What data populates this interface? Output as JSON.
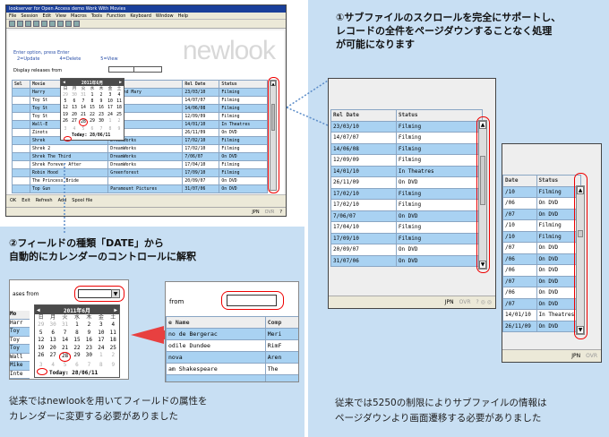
{
  "main_window": {
    "title": "lookserver for Open Access demo Work With Movies",
    "menu": [
      "File",
      "Session",
      "Edit",
      "View",
      "Macros",
      "Tools",
      "Function",
      "Keyboard",
      "Window",
      "Help"
    ],
    "brand": "newlook",
    "options_label": "Enter option, press Enter",
    "options": [
      "2=Update",
      "4=Delete",
      "5=View"
    ],
    "display_label": "Display releases from",
    "columns": [
      "Sel",
      "Movie",
      "",
      "Rel Date",
      "Status"
    ],
    "rows": [
      [
        "",
        "Harry",
        "ng, and Mary",
        "23/03/10",
        "Filming"
      ],
      [
        "",
        "Toy St",
        "Pixar",
        "14/07/07",
        "Filming"
      ],
      [
        "",
        "Toy St",
        "Pixar",
        "14/06/08",
        "Filming"
      ],
      [
        "",
        "Toy St",
        "Pixar",
        "12/09/09",
        "Filming"
      ],
      [
        "",
        "Wall-E",
        "Pixar",
        "14/01/10",
        "In Theatres"
      ],
      [
        "",
        "Zinots",
        "Pixar",
        "26/11/09",
        "On DVD"
      ],
      [
        "",
        "Shrek",
        "DreamWorks",
        "17/02/10",
        "Filming"
      ],
      [
        "",
        "Shrek 2",
        "DreamWorks",
        "17/02/10",
        "Filming"
      ],
      [
        "",
        "Shrek The Third",
        "DreamWorks",
        "7/06/07",
        "On DVD"
      ],
      [
        "",
        "Shrek Forever After",
        "DreamWorks",
        "17/04/10",
        "Filming"
      ],
      [
        "",
        "Robin Hood",
        "Greenforest",
        "17/09/10",
        "Filming"
      ],
      [
        "",
        "The Princess Bride",
        "",
        "20/09/07",
        "On DVD"
      ],
      [
        "",
        "Top Gun",
        "Paramount Pictures",
        "31/07/06",
        "On DVD"
      ]
    ],
    "bottom_buttons": [
      "OK",
      "Exit",
      "Refresh",
      "Add",
      "Spool file"
    ],
    "status": [
      "JPN",
      "OVR",
      "?"
    ]
  },
  "calendar": {
    "month": "2011年6月",
    "weekdays": [
      "日",
      "月",
      "火",
      "水",
      "木",
      "金",
      "土"
    ],
    "days": [
      "29",
      "30",
      "31",
      "1",
      "2",
      "3",
      "4",
      "5",
      "6",
      "7",
      "8",
      "9",
      "10",
      "11",
      "12",
      "13",
      "14",
      "15",
      "16",
      "17",
      "18",
      "19",
      "20",
      "21",
      "22",
      "23",
      "24",
      "25",
      "26",
      "27",
      "28",
      "29",
      "30",
      "1",
      "2",
      "3",
      "4",
      "5",
      "6",
      "7",
      "8",
      "9"
    ],
    "today_label": "Today: 28/06/11",
    "selected": "28"
  },
  "annotation1": {
    "title": "①サブファイルのスクロールを完全にサポートし、\nレコードの全件をページダウンすることなく処理\nが可能になります",
    "note": "従来では5250の制限によりサブファイルの情報は\nページダウンより画面遷移する必要がありました"
  },
  "annotation2": {
    "title": "②フィールドの種類「DATE」から\n自動的にカレンダーのコントロールに解釈",
    "note": "従来ではnewlookを用いてフィールドの属性を\nカレンダーに変更する必要がありました"
  },
  "zoom_subfile": {
    "columns": [
      "Rel Date",
      "Status"
    ],
    "rows": [
      [
        "23/03/10",
        "Filming"
      ],
      [
        "14/07/07",
        "Filming"
      ],
      [
        "14/06/08",
        "Filming"
      ],
      [
        "12/09/09",
        "Filming"
      ],
      [
        "14/01/10",
        "In Theatres"
      ],
      [
        "26/11/09",
        "On DVD"
      ],
      [
        "17/02/10",
        "Filming"
      ],
      [
        "17/02/10",
        "Filming"
      ],
      [
        "7/06/07",
        "On DVD"
      ],
      [
        "17/04/10",
        "Filming"
      ],
      [
        "17/09/10",
        "Filming"
      ],
      [
        "20/09/07",
        "On DVD"
      ],
      [
        "31/07/06",
        "On DVD"
      ]
    ],
    "status": [
      "JPN",
      "OVR"
    ]
  },
  "zoom_subfile2": {
    "columns": [
      "Date",
      "Status"
    ],
    "rows": [
      [
        "/10",
        "Filming"
      ],
      [
        "/06",
        "On DVD"
      ],
      [
        "/07",
        "On DVD"
      ],
      [
        "/10",
        "Filming"
      ],
      [
        "/10",
        "Filming"
      ],
      [
        "/07",
        "On DVD"
      ],
      [
        "/06",
        "On DVD"
      ],
      [
        "/06",
        "On DVD"
      ],
      [
        "/07",
        "On DVD"
      ],
      [
        "/06",
        "On DVD"
      ],
      [
        "/07",
        "On DVD"
      ],
      [
        "14/01/10",
        "In Theatres"
      ],
      [
        "26/11/09",
        "On DVD"
      ]
    ],
    "status": [
      "JPN",
      "OVR"
    ]
  },
  "old_approach": {
    "from_label": "from",
    "columns": [
      "e Name",
      "Comp"
    ],
    "rows": [
      [
        "no de Bergerac",
        "Meri"
      ],
      [
        "odile Dundee",
        "RimF"
      ],
      [
        "nova",
        "Aren"
      ],
      [
        "am Shakespeare",
        "The"
      ],
      [
        "",
        ""
      ]
    ]
  },
  "cal_field_zoom": {
    "label": "ases from",
    "side_rows": [
      "Mo",
      "Harr",
      "Toy",
      "Toy",
      "Toy",
      "Wall",
      "Mike",
      "Inte"
    ]
  },
  "colors": {
    "accent": "#a9d2f2",
    "panel": "#c8dff3",
    "highlight": "#e00000",
    "arrow": "#e84040"
  }
}
